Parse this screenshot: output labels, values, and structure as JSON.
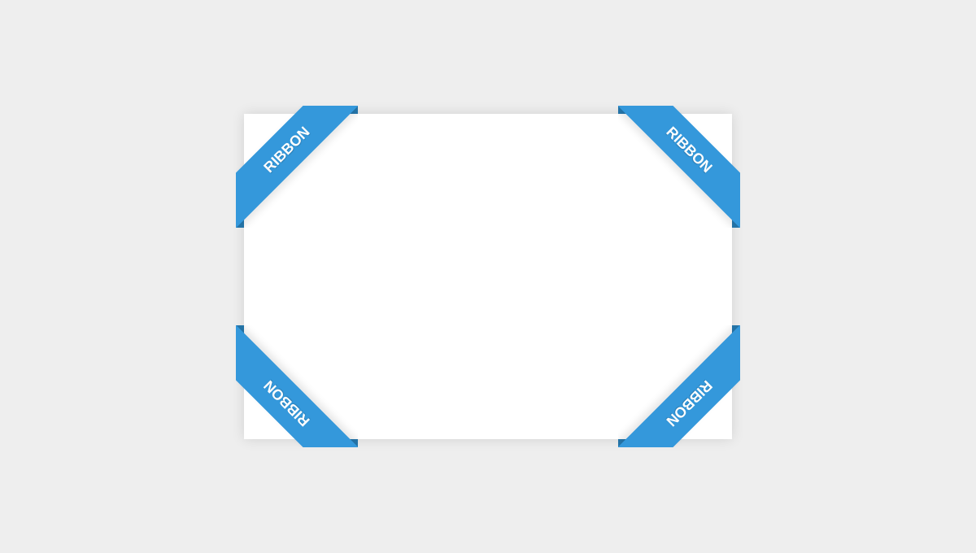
{
  "ribbons": {
    "top_left": "ribbon",
    "top_right": "ribbon",
    "bottom_left": "ribbon",
    "bottom_right": "ribbon"
  },
  "colors": {
    "ribbon_bg": "#3498db",
    "ribbon_fold": "#2980b9",
    "page_bg": "#eeeeee",
    "box_bg": "#ffffff",
    "ribbon_text": "#ffffff"
  }
}
